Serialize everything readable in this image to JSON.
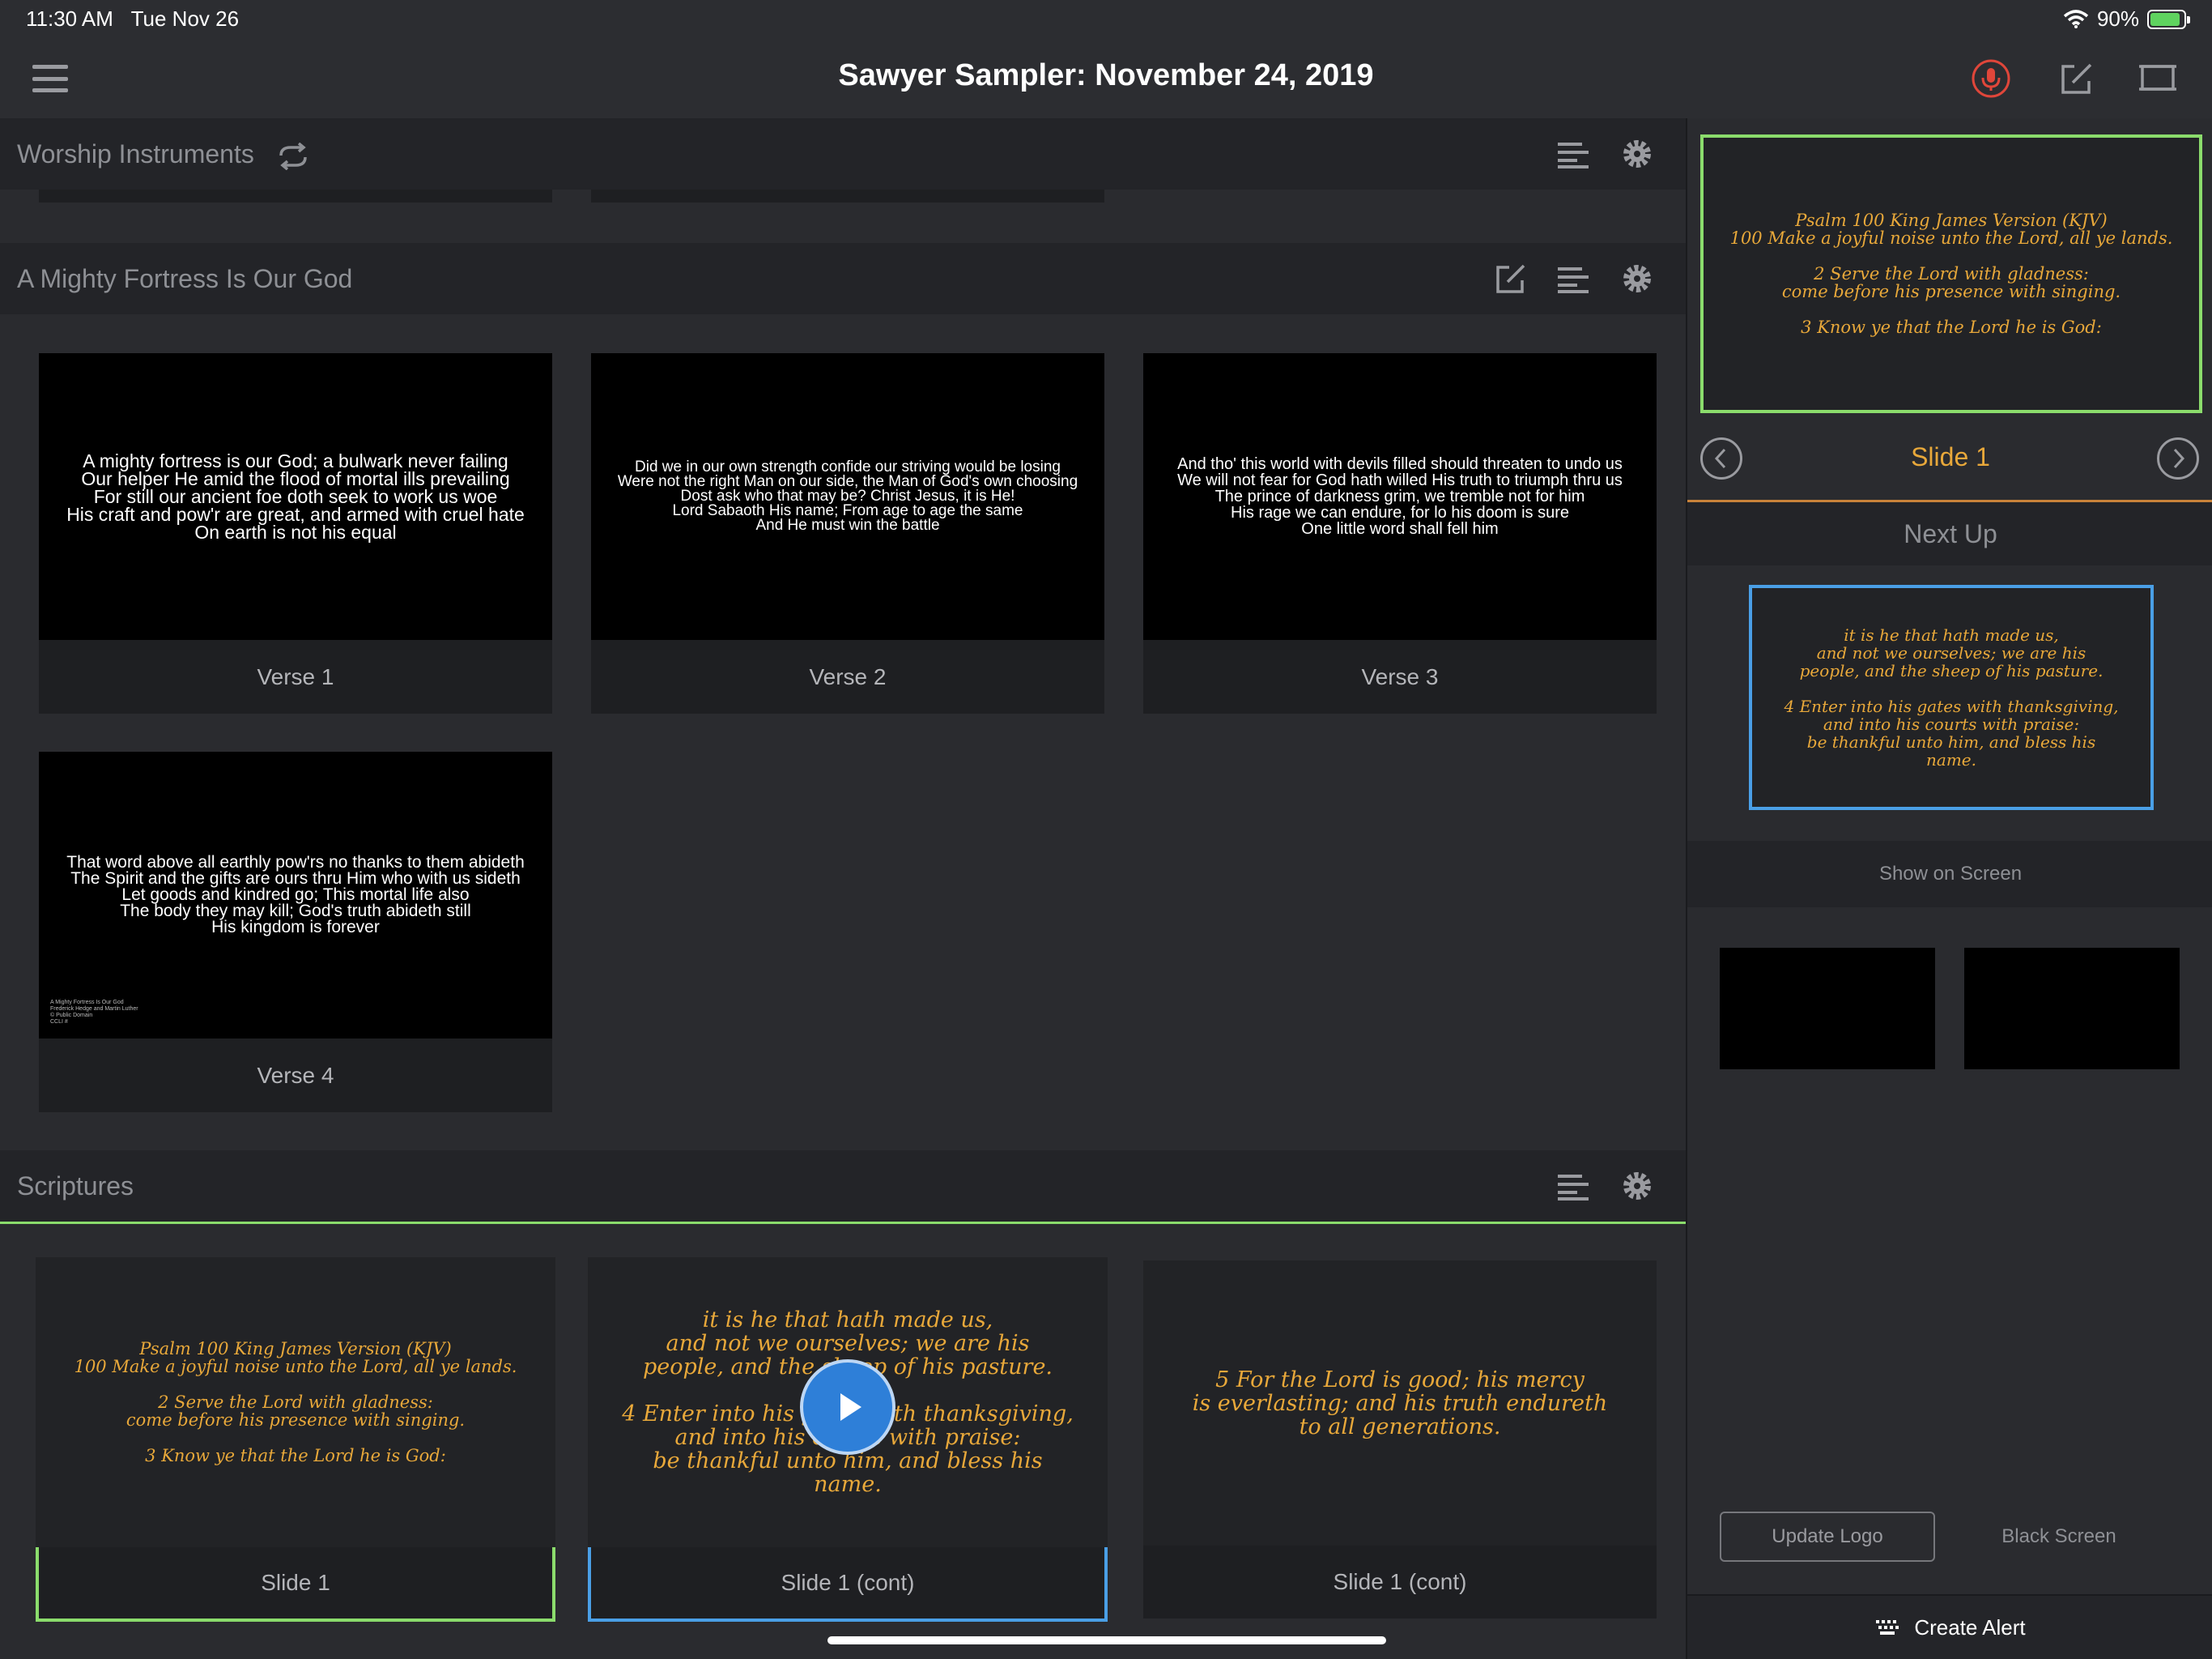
{
  "status": {
    "time": "11:30 AM",
    "date": "Tue Nov 26",
    "battery": "90%"
  },
  "nav": {
    "title": "Sawyer Sampler: November 24, 2019"
  },
  "sections": {
    "worship": {
      "title": "Worship Instruments"
    },
    "fortress": {
      "title": "A Mighty Fortress Is Our God",
      "cards": [
        {
          "label": "Verse 1",
          "text": "A mighty fortress is our God; a bulwark never failing\nOur helper He amid the flood of mortal ills prevailing\nFor still our ancient foe doth seek to work us woe\nHis craft and pow'r are great, and armed with cruel hate\nOn earth is not his equal"
        },
        {
          "label": "Verse 2",
          "text": "Did we in our own strength confide our striving would be losing\nWere not the right Man on our side, the Man of God's own choosing\nDost ask who that may be? Christ Jesus, it is He!\nLord Sabaoth His name; From age to age the same\nAnd He must win the battle"
        },
        {
          "label": "Verse 3",
          "text": "And tho' this world with devils filled should threaten to undo us\nWe will not fear for God hath willed His truth to triumph thru us\nThe prince of darkness grim, we tremble not for him\nHis rage we can endure, for lo his doom is sure\nOne little word shall fell him"
        },
        {
          "label": "Verse 4",
          "text": "That word above all earthly pow'rs no thanks to them abideth\nThe Spirit and the gifts are ours thru Him who with us sideth\nLet goods and kindred go; This mortal life also\nThe body they may kill; God's truth abideth still\nHis kingdom is forever",
          "copyright": "A Mighty Fortress Is Our God\nFrederick Hedge and Martin Luther\n© Public Domain\nCCLI #"
        }
      ]
    },
    "scriptures": {
      "title": "Scriptures",
      "cards": [
        {
          "label": "Slide 1",
          "text": "Psalm 100 King James Version (KJV)\n100 Make a joyful noise unto the Lord, all ye lands.\n\n2 Serve the Lord with gladness:\ncome before his presence with singing.\n\n3 Know ye that the Lord he is God:"
        },
        {
          "label": "Slide 1 (cont)",
          "text": "it is he that hath made us,\nand not we ourselves; we are his\npeople, and the sheep of his pasture.\n\n4 Enter into his gates with thanksgiving,\nand into his courts with praise:\nbe thankful unto him, and bless his\nname."
        },
        {
          "label": "Slide 1 (cont)",
          "text": "5 For the Lord is good; his mercy\nis everlasting; and his truth endureth\nto all generations."
        }
      ]
    }
  },
  "right": {
    "preview_text": "Psalm 100 King James Version (KJV)\n100 Make a joyful noise unto the Lord, all ye lands.\n\n2 Serve the Lord with gladness:\ncome before his presence with singing.\n\n3 Know ye that the Lord he is God:",
    "slide_name": "Slide 1",
    "next_up": "Next Up",
    "next_text": "it is he that hath made us,\nand not we ourselves; we are his\npeople, and the sheep of his pasture.\n\n4 Enter into his gates with thanksgiving,\nand into his courts with praise:\nbe thankful unto him, and bless his\nname.",
    "show_on_screen": "Show on Screen",
    "update_logo": "Update Logo",
    "black_screen": "Black Screen",
    "create_alert": "Create Alert"
  },
  "colors": {
    "accent_orange": "#e8a83a",
    "live_green": "#8bdc6c",
    "next_blue": "#4a9fe6",
    "mic_red": "#e0463a"
  },
  "icons": [
    "hamburger-icon",
    "microphone-icon",
    "edit-icon",
    "display-icon",
    "sync-icon",
    "list-icon",
    "gear-icon",
    "chevron-left-icon",
    "chevron-right-icon",
    "play-icon",
    "keyboard-icon",
    "wifi-icon",
    "battery-icon"
  ]
}
